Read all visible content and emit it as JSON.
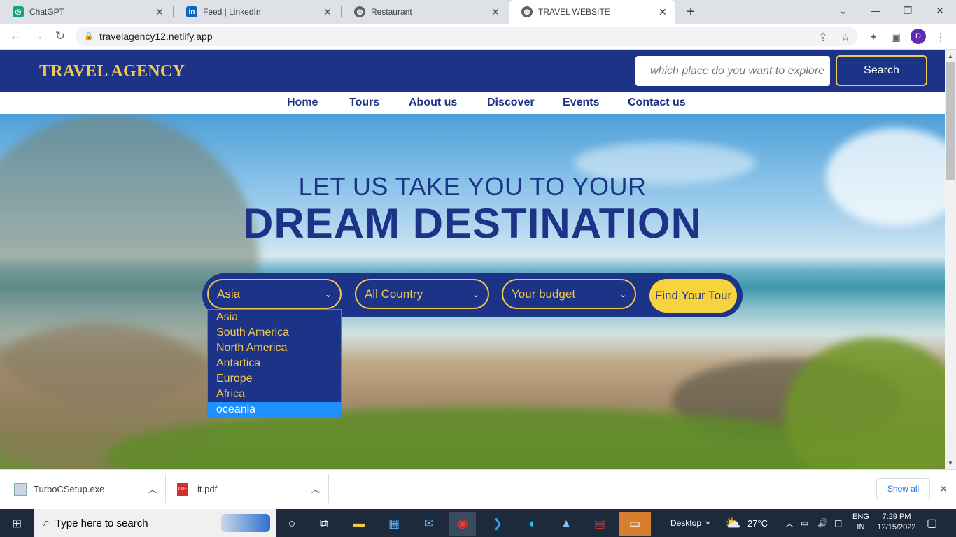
{
  "browser": {
    "tabs": [
      {
        "title": "ChatGPT",
        "icon": "chatgpt-icon"
      },
      {
        "title": "Feed | LinkedIn",
        "icon": "linkedin-icon"
      },
      {
        "title": "Restaurant",
        "icon": "globe-icon"
      },
      {
        "title": "TRAVEL WEBSITE",
        "icon": "globe-icon",
        "active": true
      }
    ],
    "url": "travelagency12.netlify.app",
    "profile_initial": "D"
  },
  "site": {
    "brand": "TRAVEL AGENCY",
    "search_placeholder": "which place do you want to explore...",
    "search_button": "Search",
    "nav": [
      "Home",
      "Tours",
      "About us",
      "Discover",
      "Events",
      "Contact us"
    ],
    "headline_small": "LET US TAKE YOU TO YOUR",
    "headline_big": "DREAM DESTINATION",
    "filters": {
      "region": "Asia",
      "country": "All Country",
      "budget": "Your budget",
      "find_button": "Find Your Tour"
    },
    "region_options": [
      "Asia",
      "South America",
      "North America",
      "Antartica",
      "Europe",
      "Africa",
      "oceania"
    ],
    "highlighted_option": "oceania"
  },
  "downloads": {
    "items": [
      "TurboCSetup.exe",
      "it.pdf"
    ],
    "show_all": "Show all"
  },
  "taskbar": {
    "search_placeholder": "Type here to search",
    "desktop_label": "Desktop",
    "temperature": "27°C",
    "language": "ENG",
    "region": "IN",
    "time": "7:29 PM",
    "date": "12/15/2022"
  },
  "colors": {
    "brand_navy": "#1d3387",
    "brand_gold": "#f2c94c",
    "highlight": "#1e90ff"
  }
}
